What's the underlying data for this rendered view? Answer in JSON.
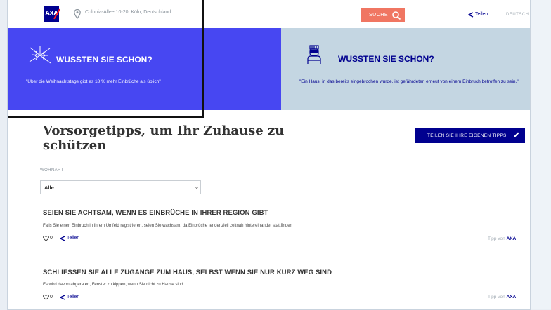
{
  "header": {
    "logo_text": "AXA",
    "address": "Colonia-Allee 10-20, Köln, Deutschland",
    "search_label": "SUCHE",
    "share_label": "Teilen",
    "language": "DEUTSCH"
  },
  "tiles": [
    {
      "title": "WUSSTEN SIE SCHON?",
      "text": "\"Über die Weihnachtstage gibt es 18 % mehr Einbrüche als üblich\"",
      "icon": "broken-glass-icon",
      "color": "#4747f2"
    },
    {
      "title": "WUSSTEN SIE SCHON?",
      "text": "\"Ein Haus, in das bereits eingebrochen wurde, ist gefährdeter, erneut von einem Einbruch betroffen zu sein.\"",
      "icon": "burglar-icon",
      "color": "#c4d6e2"
    }
  ],
  "main": {
    "title": "Vorsorgetipps, um Ihr Zuhause zu schützen",
    "share_own_tip": "TEILEN SIE IHRE EIGENEN TIPPS"
  },
  "filter": {
    "label": "WOHNART",
    "selected": "Alle"
  },
  "tips": [
    {
      "title": "SEIEN SIE ACHTSAM, WENN ES EINBRÜCHE IN IHRER REGION GIBT",
      "description": "Falls Sie einen Einbruch in Ihrem Umfeld registrieren, seien Sie wachsam, da Einbrüche tendenziell zeitnah hintereinander stattfinden",
      "likes": "0",
      "share": "Teilen",
      "by_label": "Tipp von",
      "by_author": "AXA"
    },
    {
      "title": "SCHLIESSEN SIE ALLE ZUGÄNGE ZUM HAUS, SELBST WENN SIE NUR KURZ WEG SIND",
      "description": "Es wird davon abgeraten, Fenster zu kippen, wenn Sie nicht zu Hause sind",
      "likes": "0",
      "share": "Teilen",
      "by_label": "Tipp von",
      "by_author": "AXA"
    }
  ],
  "colors": {
    "brand_blue": "#00008f",
    "accent_red": "#ff1721",
    "search_orange": "#f07662"
  }
}
